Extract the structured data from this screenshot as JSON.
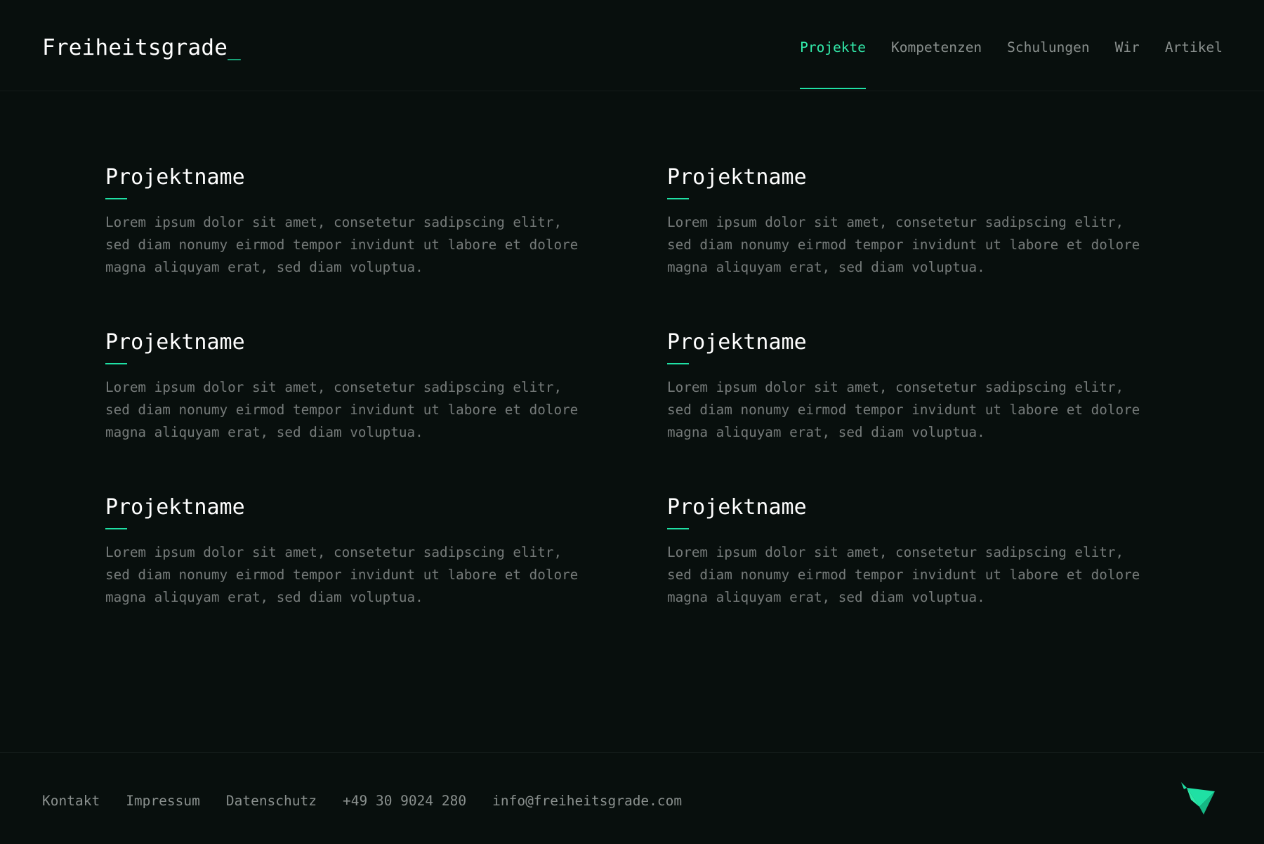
{
  "header": {
    "logo_text": "Freiheitsgrade",
    "logo_cursor": "_",
    "nav": [
      {
        "label": "Projekte",
        "active": true
      },
      {
        "label": "Kompetenzen",
        "active": false
      },
      {
        "label": "Schulungen",
        "active": false
      },
      {
        "label": "Wir",
        "active": false
      },
      {
        "label": "Artikel",
        "active": false
      }
    ]
  },
  "projects": [
    {
      "title": "Projektname",
      "description": "Lorem ipsum dolor sit amet, consetetur sadipscing elitr,\nsed diam nonumy eirmod tempor invidunt ut labore et dolore\nmagna aliquyam erat, sed diam voluptua."
    },
    {
      "title": "Projektname",
      "description": "Lorem ipsum dolor sit amet, consetetur sadipscing elitr,\nsed diam nonumy eirmod tempor invidunt ut labore et dolore\nmagna aliquyam erat, sed diam voluptua."
    },
    {
      "title": "Projektname",
      "description": "Lorem ipsum dolor sit amet, consetetur sadipscing elitr,\nsed diam nonumy eirmod tempor invidunt ut labore et dolore\nmagna aliquyam erat, sed diam voluptua."
    },
    {
      "title": "Projektname",
      "description": "Lorem ipsum dolor sit amet, consetetur sadipscing elitr,\nsed diam nonumy eirmod tempor invidunt ut labore et dolore\nmagna aliquyam erat, sed diam voluptua."
    },
    {
      "title": "Projektname",
      "description": "Lorem ipsum dolor sit amet, consetetur sadipscing elitr,\nsed diam nonumy eirmod tempor invidunt ut labore et dolore\nmagna aliquyam erat, sed diam voluptua."
    },
    {
      "title": "Projektname",
      "description": "Lorem ipsum dolor sit amet, consetetur sadipscing elitr,\nsed diam nonumy eirmod tempor invidunt ut labore et dolore\nmagna aliquyam erat, sed diam voluptua."
    }
  ],
  "footer": {
    "links": [
      "Kontakt",
      "Impressum",
      "Datenschutz",
      "+49 30 9024 280",
      "info@freiheitsgrade.com"
    ],
    "logo_icon": "origami-bird-icon"
  },
  "colors": {
    "background": "#080f0d",
    "accent": "#1fe0a4",
    "text_primary": "#ffffff",
    "text_muted": "#8a908e",
    "text_body": "#767b7a"
  }
}
